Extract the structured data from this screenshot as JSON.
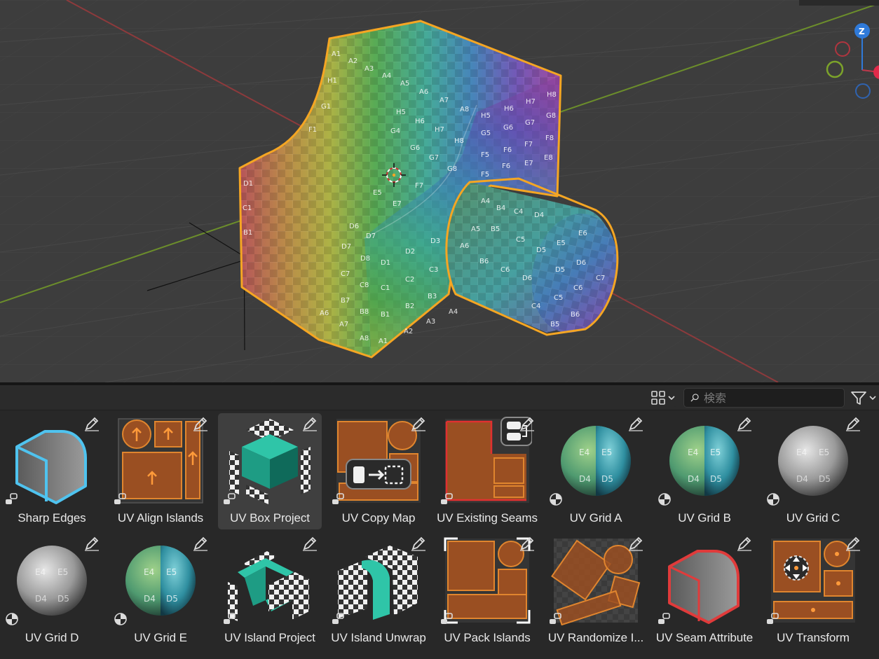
{
  "viewport": {
    "gizmo": {
      "z_label": "Z"
    },
    "mesh_face_labels": [
      "A1",
      "A2",
      "A3",
      "A4",
      "A5",
      "A6",
      "A7",
      "A8",
      "H1",
      "H5",
      "H6",
      "H7",
      "H8",
      "G1",
      "G5",
      "G6",
      "G7",
      "G8",
      "F1",
      "F5",
      "F6",
      "F7",
      "F8",
      "E1",
      "E5",
      "E6",
      "E7",
      "E8",
      "D1",
      "D2",
      "D3",
      "D5",
      "D6",
      "D7",
      "D8",
      "C1",
      "C2",
      "C3",
      "C5",
      "C6",
      "C7",
      "C8",
      "B1",
      "B2",
      "B3",
      "B5",
      "B6",
      "B7",
      "B8",
      "A1",
      "A2",
      "A3",
      "A4",
      "A5",
      "A6",
      "A7",
      "A8"
    ]
  },
  "asset_panel": {
    "search": {
      "placeholder": "検索",
      "value": ""
    },
    "assets": [
      {
        "label": "Sharp Edges",
        "thumb": "sharp-edges",
        "type_icon": "node-group-icon"
      },
      {
        "label": "UV Align Islands",
        "thumb": "uv-align",
        "type_icon": "node-group-icon"
      },
      {
        "label": "UV Box Project",
        "thumb": "uv-box",
        "type_icon": "node-group-icon",
        "selected": true
      },
      {
        "label": "UV Copy Map",
        "thumb": "uv-copy",
        "type_icon": "node-group-icon"
      },
      {
        "label": "UV Existing Seams",
        "thumb": "uv-seams",
        "type_icon": "node-group-icon"
      },
      {
        "label": "UV Grid A",
        "thumb": "sphere-color",
        "type_icon": "material-icon"
      },
      {
        "label": "UV Grid B",
        "thumb": "sphere-color",
        "type_icon": "material-icon"
      },
      {
        "label": "UV Grid C",
        "thumb": "sphere-grey",
        "type_icon": "material-icon"
      },
      {
        "label": "UV Grid D",
        "thumb": "sphere-grey",
        "type_icon": "material-icon"
      },
      {
        "label": "UV Grid E",
        "thumb": "sphere-color",
        "type_icon": "material-icon"
      },
      {
        "label": "UV Island Project",
        "thumb": "uv-island-project",
        "type_icon": "node-group-icon"
      },
      {
        "label": "UV Island Unwrap",
        "thumb": "uv-island-unwrap",
        "type_icon": "node-group-icon"
      },
      {
        "label": "UV Pack Islands",
        "thumb": "uv-pack",
        "type_icon": "node-group-icon"
      },
      {
        "label": "UV Randomize I...",
        "thumb": "uv-randomize",
        "type_icon": "node-group-icon"
      },
      {
        "label": "UV Seam Attribute",
        "thumb": "uv-seam-attr",
        "type_icon": "node-group-icon"
      },
      {
        "label": "UV Transform",
        "thumb": "uv-transform",
        "type_icon": "node-group-icon"
      }
    ],
    "sphere_labels": [
      "E4",
      "E5",
      "D4",
      "D5"
    ]
  },
  "colors": {
    "selection_outline": "#f5a623",
    "uv_orange": "#b45a22",
    "x_axis": "#a33a3a",
    "y_axis": "#6f9a25",
    "gizmo_z": "#2f7ad9"
  }
}
